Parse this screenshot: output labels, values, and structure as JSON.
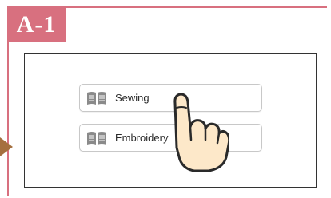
{
  "step": {
    "label": "A-1"
  },
  "menu": {
    "items": [
      {
        "label": "Sewing",
        "icon": "book-icon"
      },
      {
        "label": "Embroidery",
        "icon": "book-icon"
      }
    ]
  },
  "colors": {
    "accent": "#d8707f",
    "arrow": "#a5703f",
    "screen_border": "#333333",
    "button_border": "#c8c8c8"
  },
  "pointer": {
    "icon": "pointing-hand-icon"
  }
}
